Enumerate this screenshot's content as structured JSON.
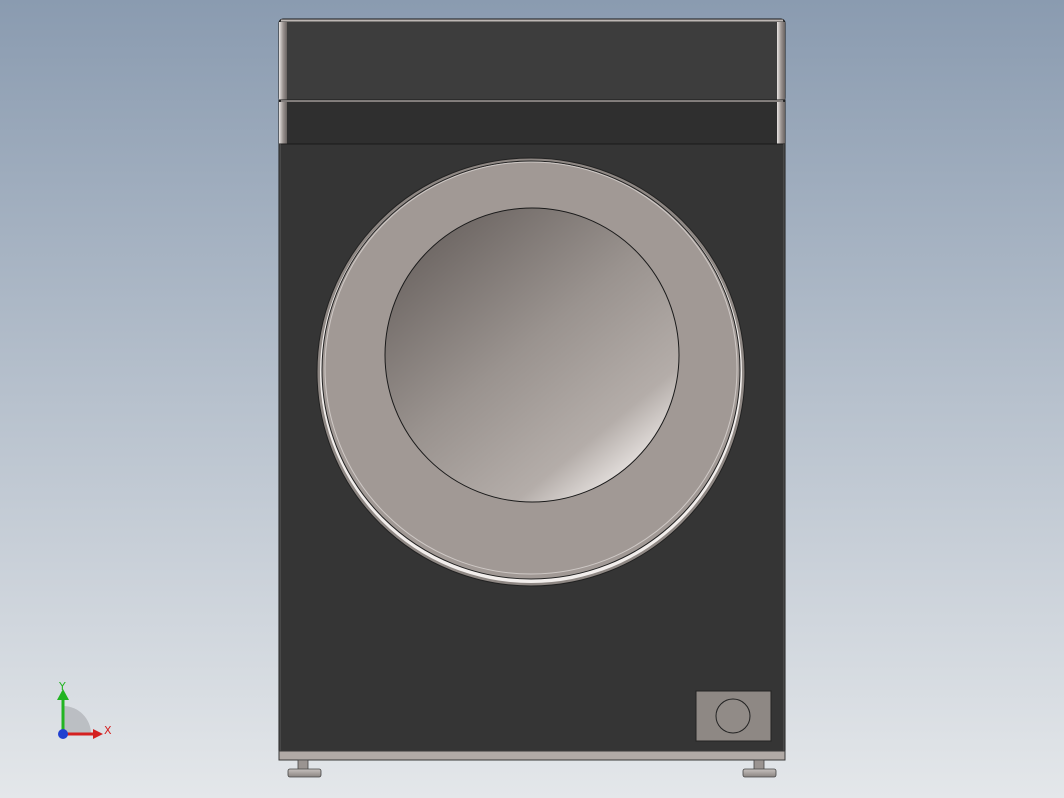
{
  "viewport": {
    "background_top": "#8a9bb0",
    "background_bottom": "#e4e7ea"
  },
  "model": {
    "body_color": "#353535",
    "top_panel_color": "#3c3c3c",
    "ring_color": "#a19995",
    "glass_color": "#9b9490"
  },
  "triad": {
    "y_label": "Y",
    "x_label": "X",
    "y_color": "#22b422",
    "x_color": "#d42020",
    "z_color": "#2040d0"
  }
}
